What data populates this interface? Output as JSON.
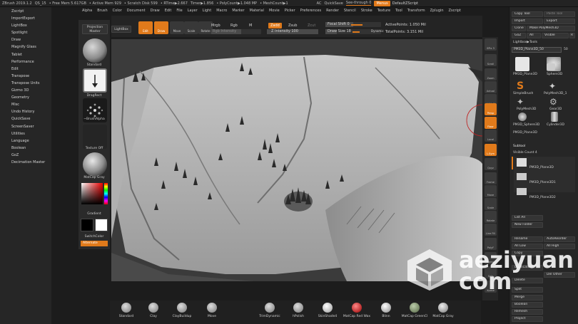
{
  "titlebar": {
    "app": "ZBrush 2019.1.2",
    "doc": "QS_15",
    "free_mem": "• Free Mem 5.617GB",
    "active_mem": "• Active Mem 929",
    "scratch": "• Scratch Disk 599",
    "rtime": "• RTime▶2.667",
    "timer": "Timer▶1.856",
    "polycount": "• PolyCount▶1.048 MP",
    "meshcount": "• MeshCount▶1",
    "ac": "AC",
    "quicksave": "QuickSave",
    "seethrough": "See-through 0",
    "menus": "Menus",
    "default_script": "DefaultZScript"
  },
  "menubar": [
    "Alpha",
    "Brush",
    "Color",
    "Document",
    "Draw",
    "Edit",
    "File",
    "Layer",
    "Light",
    "Macro",
    "Marker",
    "Material",
    "Movie",
    "Picker",
    "Preferences",
    "Render",
    "Stencil",
    "Stroke",
    "Texture",
    "Tool",
    "Transform",
    "Zplugin",
    "Zscript"
  ],
  "leftlist": [
    "Zscript",
    "ImportExport",
    "LightBox",
    "Spotlight",
    "Draw",
    "Magnify Glass",
    "Tablet",
    "Performance",
    "Edit",
    "Transpose",
    "Transpose Units",
    "Gizmo 3D",
    "Geometry",
    "Misc",
    "Undo History",
    "QuickSave",
    "ScreenSaver",
    "Utilities",
    "Language",
    "Boolean",
    "GoZ",
    "Decimation Master"
  ],
  "shelf": {
    "projection_master": "Projection Master",
    "lightbox": "LightBox",
    "brush_label": "Standard",
    "stroke_label": "DragRect",
    "alpha_label": "~BrushAlpha",
    "texture_label": "Texture Off",
    "material_label": "MatCap Gray",
    "gradient_label": "Gradient",
    "switchcolor_label": "SwitchColor",
    "alternate_label": "Alternate"
  },
  "toptools": {
    "edit": "Edit",
    "draw": "Draw",
    "move": "Move",
    "scale": "Scale",
    "rotate": "Rotate",
    "mrgb": "Mrgb",
    "rgb": "Rgb",
    "m": "M",
    "zadd": "Zadd",
    "zsub": "Zsub",
    "zcut": "Zcut",
    "rgb_intensity": "Rgb Intensity",
    "z_intensity": "Z Intensity 100",
    "focal_shift": "Focal Shift 0",
    "draw_size": "Draw Size 18",
    "dynamic": "Dynamic",
    "active_points": "ActivePoints: 1.050 Mil",
    "total_points": "TotalPoints: 3.151 Mil"
  },
  "rstrip": [
    "SPix 3",
    "Scroll",
    "Zoom",
    "Actual",
    "AAHalf",
    "Persp",
    "Floor",
    "Local",
    "L.Sym",
    "Qxyz",
    "Frame",
    "Move",
    "Scale",
    "Rotate",
    "Line Fill",
    "PolyF",
    "Transp",
    "Solo",
    "Xpose"
  ],
  "rpanel": {
    "copy_tool": "Copy Tool",
    "paste_tool": "Paste Tool",
    "import": "Import",
    "export": "Export",
    "clone": "Clone",
    "make_polymesh": "Make PolyMesh3D",
    "goz": "GoZ",
    "all": "All",
    "visible": "Visible",
    "r": "R",
    "lightbox_tools": "Lightbox▶Tools",
    "current_tool": "PM3D_Plane3D_50",
    "current_value": "50",
    "tools": [
      "PM3D_Plane3D",
      "Plane3D",
      "SimpleBrush",
      "PolyMesh3D_1",
      "PolyMesh3D",
      "Gear3D",
      "PM3D_Sphere3D",
      "Cylinder3D",
      "PM3D_Plane3D",
      "Sphere3D"
    ],
    "subtool": "Subtool",
    "visible_count": "Visible Count 4",
    "subtools": [
      "PM3D_Plane3D",
      "PM3D_Plane3D1",
      "PM3D_Plane3D2"
    ],
    "list_all": "List All",
    "new_folder": "New Folder",
    "rename": "Rename",
    "autoreorder": "AutoReorder",
    "all_low": "All Low",
    "all_high": "All High",
    "copy": "Copy",
    "duplicate": "Duplicate",
    "del_other": "Del Other",
    "delete": "Delete",
    "split": "Split",
    "merge": "Merge",
    "boolean": "Boolean",
    "remesh": "Remesh",
    "project": "Project"
  },
  "bottom": [
    "Standard",
    "Clay",
    "ClayBuildup",
    "Move",
    "TrimDynamic",
    "hPolish",
    "SkinShade4",
    "MatCap Red Wax",
    "Blinn",
    "MatCap GreenCl",
    "MatCap Gray"
  ],
  "watermark": {
    "line1": "aeziyuan",
    "line2": "com"
  },
  "colors": {
    "accent": "#e07a1b",
    "bg": "#1c1c1c",
    "panel": "#262626"
  }
}
